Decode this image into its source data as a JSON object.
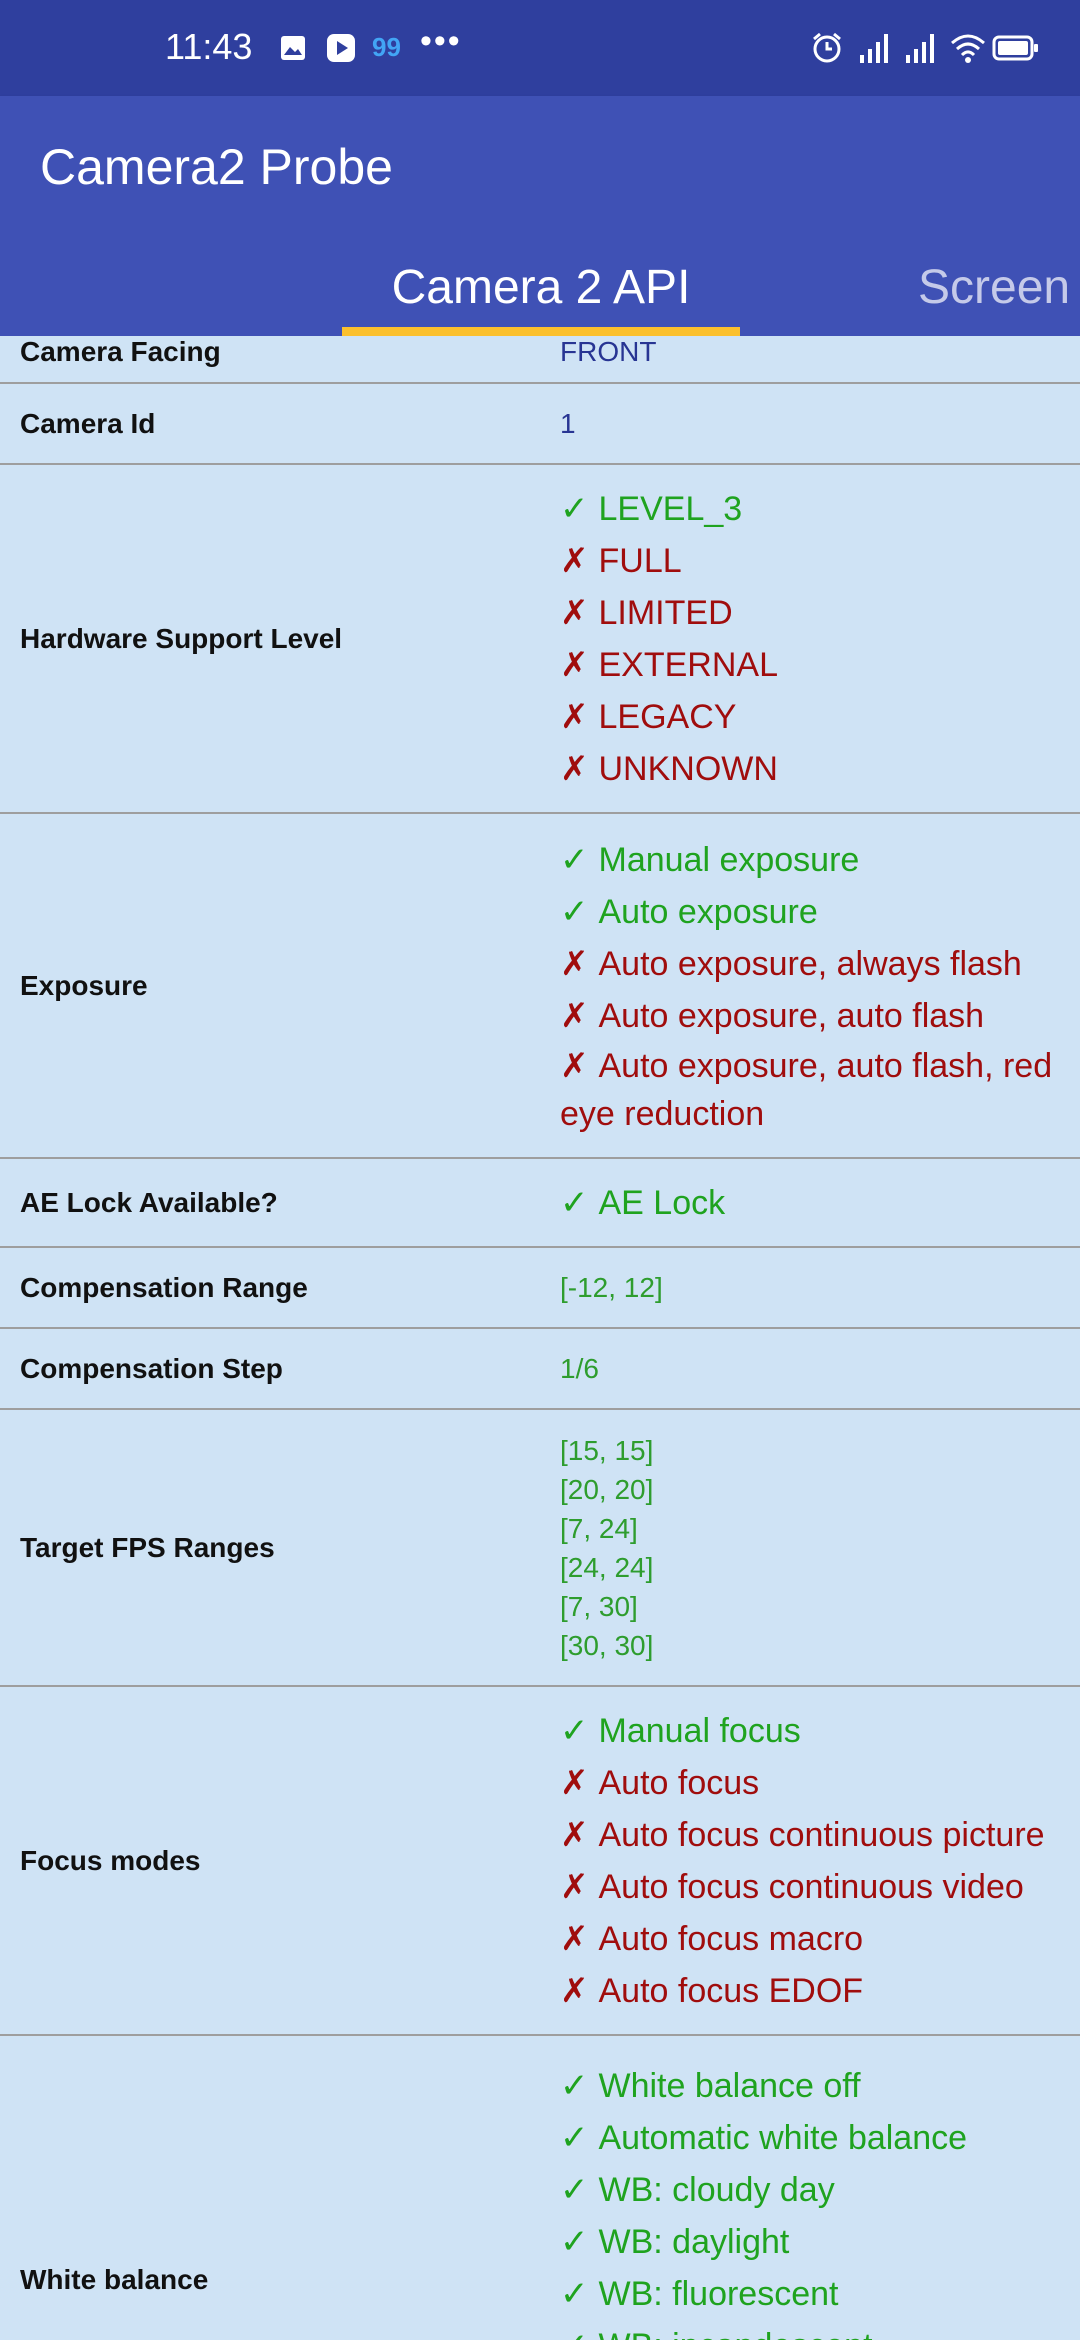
{
  "status_bar": {
    "time": "11:43",
    "badge_count": "99",
    "more": "•••",
    "icons": [
      "notification-image-icon",
      "play-icon",
      "alarm-icon",
      "signal-1-icon",
      "signal-2-icon",
      "wifi-icon",
      "battery-icon"
    ]
  },
  "app_bar": {
    "title": "Camera2 Probe"
  },
  "tabs": [
    {
      "label": "Camera 2 API",
      "active": true
    },
    {
      "label": "Screen",
      "active": false
    }
  ],
  "accent_color": "#fbc02d",
  "rows": {
    "camera_facing": {
      "label": "Camera Facing",
      "value": "FRONT"
    },
    "camera_id": {
      "label": "Camera Id",
      "value": "1"
    },
    "hardware_support_level": {
      "label": "Hardware Support Level",
      "items": [
        {
          "mark": "✓",
          "text": "LEVEL_3"
        },
        {
          "mark": "✗",
          "text": "FULL"
        },
        {
          "mark": "✗",
          "text": "LIMITED"
        },
        {
          "mark": "✗",
          "text": "EXTERNAL"
        },
        {
          "mark": "✗",
          "text": "LEGACY"
        },
        {
          "mark": "✗",
          "text": "UNKNOWN"
        }
      ]
    },
    "exposure": {
      "label": "Exposure",
      "items": [
        {
          "mark": "✓",
          "text": "Manual exposure"
        },
        {
          "mark": "✓",
          "text": "Auto exposure"
        },
        {
          "mark": "✗",
          "text": "Auto exposure, always flash"
        },
        {
          "mark": "✗",
          "text": "Auto exposure, auto flash"
        },
        {
          "mark": "✗",
          "text": "Auto exposure, auto flash, red eye reduction"
        }
      ]
    },
    "ae_lock": {
      "label": "AE Lock Available?",
      "items": [
        {
          "mark": "✓",
          "text": "AE Lock"
        }
      ]
    },
    "compensation_range": {
      "label": "Compensation Range",
      "value": "[-12, 12]"
    },
    "compensation_step": {
      "label": "Compensation Step",
      "value": "1/6"
    },
    "target_fps_ranges": {
      "label": "Target FPS Ranges",
      "values": [
        "[15, 15]",
        "[20, 20]",
        "[7, 24]",
        "[24, 24]",
        "[7, 30]",
        "[30, 30]"
      ]
    },
    "focus_modes": {
      "label": "Focus modes",
      "items": [
        {
          "mark": "✓",
          "text": "Manual focus"
        },
        {
          "mark": "✗",
          "text": "Auto focus"
        },
        {
          "mark": "✗",
          "text": "Auto focus continuous picture"
        },
        {
          "mark": "✗",
          "text": "Auto focus continuous video"
        },
        {
          "mark": "✗",
          "text": "Auto focus macro"
        },
        {
          "mark": "✗",
          "text": "Auto focus EDOF"
        }
      ]
    },
    "white_balance": {
      "label": "White balance",
      "items": [
        {
          "mark": "✓",
          "text": "White balance off"
        },
        {
          "mark": "✓",
          "text": "Automatic white balance"
        },
        {
          "mark": "✓",
          "text": "WB: cloudy day"
        },
        {
          "mark": "✓",
          "text": "WB: daylight"
        },
        {
          "mark": "✓",
          "text": "WB: fluorescent"
        },
        {
          "mark": "✓",
          "text": "WB: incandescent"
        }
      ]
    }
  }
}
